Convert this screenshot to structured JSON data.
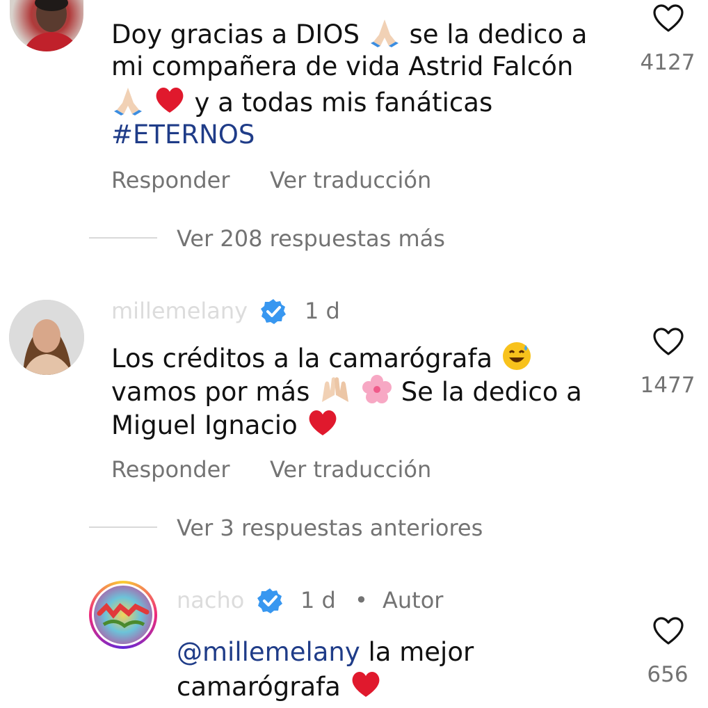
{
  "comments": [
    {
      "username": "",
      "time": "",
      "text_line1_a": "Doy gracias a DIOS",
      "text_line1_b": "se la dedico a",
      "text_line2": "mi compañera de vida Astrid Falcón",
      "text_line3": "y a todas mis fanáticas",
      "hashtag": "#ETERNOS",
      "likes": "4127",
      "reply_label": "Responder",
      "translate_label": "Ver traducción",
      "more_replies": "Ver 208 respuestas más"
    },
    {
      "username": "millemelany",
      "verified": true,
      "time": "1 d",
      "text_line1": "Los créditos a la camarógrafa",
      "text_line2_a": "vamos por más",
      "text_line2_b": "Se la dedico a",
      "text_line3": "Miguel Ignacio",
      "likes": "1477",
      "reply_label": "Responder",
      "translate_label": "Ver traducción",
      "previous_replies": "Ver 3 respuestas anteriores"
    },
    {
      "username": "nacho",
      "verified": true,
      "time": "1 d",
      "author_badge": "Autor",
      "mention": "@millemelany",
      "text_line1_rest": " la mejor",
      "text_line2": "camarógrafa",
      "likes": "656"
    }
  ],
  "icons": {
    "heart": "heart-outline-icon",
    "verified": "verified-badge-icon",
    "pray": "folded-hands-emoji",
    "red_heart": "red-heart-emoji",
    "raised_hands": "raised-hands-emoji",
    "cherry_blossom": "cherry-blossom-emoji",
    "sweat_smile": "grinning-sweat-emoji"
  },
  "colors": {
    "text": "#111111",
    "secondary": "#737373",
    "link": "#1f3c88",
    "verified": "#3897f0",
    "heart_emoji": "#e0192d"
  }
}
